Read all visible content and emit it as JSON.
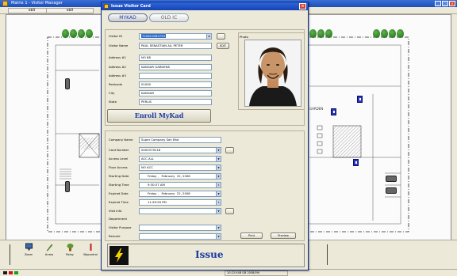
{
  "app": {
    "title": "Matrix 1 - Visitor Manager",
    "tabs": [
      "eb0",
      "eb0"
    ]
  },
  "floor_plan": {
    "garden_label": "GARDEN"
  },
  "toolbar": {
    "items": [
      {
        "label": "Zoom",
        "icon": "monitor-icon"
      },
      {
        "label": "Arrow",
        "icon": "pen-icon"
      },
      {
        "label": "Relay",
        "icon": "plant-icon"
      },
      {
        "label": "Wgcontrol",
        "icon": "bar-icon"
      }
    ]
  },
  "status_bar": {
    "datetime": "10:22:54B GB 2008/09/",
    "led_colors": [
      "#1a1a1a",
      "#d01818",
      "#18a018"
    ]
  },
  "dialog": {
    "title": "Issue Visitor Card",
    "close_glyph": "×",
    "tabs": {
      "mykad": "MYKAD",
      "old_ic": "OLD IC"
    },
    "visitor": {
      "visitor_id_label": "Visitor ID",
      "visitor_id_value": "720810085790",
      "visitor_name_label": "Visitor Name",
      "visitor_name_value": "PAUL SEBASTIAN A/L PETER",
      "address1_label": "Address #1",
      "address1_value": "NO 88",
      "address2_label": "Address #2",
      "address2_value": "KANGAR GARDENS",
      "address3_label": "Address #3",
      "address3_value": "",
      "postcode_label": "Postcode",
      "postcode_value": "01000",
      "city_label": "City",
      "city_value": "KANGAR",
      "state_label": "State",
      "state_value": "PERLIS",
      "photo_label": "Photo",
      "edit_button": "EDIT"
    },
    "enroll_button": "Enroll MyKad",
    "card": {
      "company_label": "Company Name",
      "company_value": "Super Company Sdn Bhd",
      "card_number_label": "Card Number",
      "card_number_value": "0000379218",
      "access_level_label": "Access Level",
      "access_level_value": "ACC ALL",
      "floor_access_label": "Floor Access",
      "floor_access_value": "NO ACC",
      "starting_date_label": "Starting Date",
      "starting_date_value": "Friday ,   February  22, 2008",
      "starting_time_label": "Starting Time",
      "starting_time_value": "9:30:37 AM",
      "expired_date_label": "Expired Date",
      "expired_date_value": "Friday ,   February  22, 2008",
      "expired_time_label": "Expired Time",
      "expired_time_value": "11:59:59 PM",
      "visit_info_label": "Visit Info",
      "visit_info_value": "",
      "department_label": "Department",
      "visitor_purpose_label": "Visitor Purpose",
      "visitor_purpose_value": "",
      "remark_label": "Remark",
      "remark_value": "",
      "print_button": "Print",
      "preview_button": "Preview"
    },
    "issue_button": "Issue"
  }
}
